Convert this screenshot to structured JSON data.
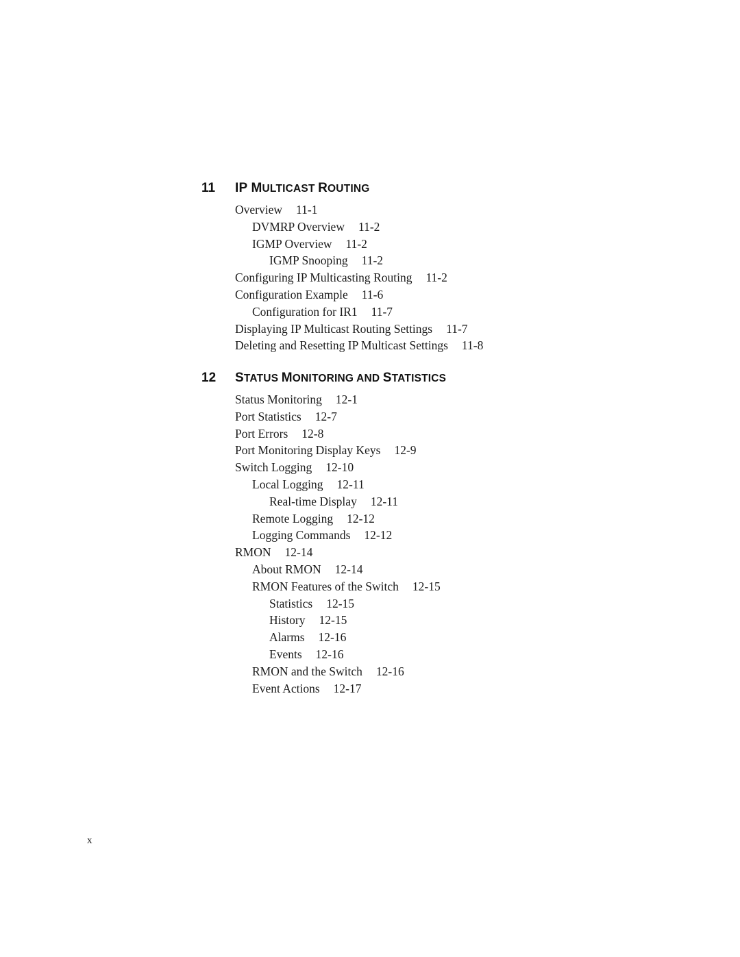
{
  "chapters": [
    {
      "number": "11",
      "title_parts": [
        {
          "t": "I",
          "cap": true
        },
        {
          "t": "P ",
          "cap": true
        },
        {
          "t": "M",
          "cap": true
        },
        {
          "t": "ULTICAST ",
          "cap": false
        },
        {
          "t": "R",
          "cap": true
        },
        {
          "t": "OUTING",
          "cap": false
        }
      ],
      "title": "IP Multicast Routing",
      "entries": [
        {
          "level": 1,
          "text": "Overview",
          "page": "11-1"
        },
        {
          "level": 2,
          "text": "DVMRP Overview",
          "page": "11-2"
        },
        {
          "level": 2,
          "text": "IGMP Overview",
          "page": "11-2"
        },
        {
          "level": 3,
          "text": "IGMP Snooping",
          "page": "11-2"
        },
        {
          "level": 1,
          "text": "Configuring IP Multicasting Routing",
          "page": "11-2"
        },
        {
          "level": 1,
          "text": "Configuration Example",
          "page": "11-6"
        },
        {
          "level": 2,
          "text": "Configuration for IR1",
          "page": "11-7"
        },
        {
          "level": 1,
          "text": "Displaying IP Multicast Routing Settings",
          "page": "11-7"
        },
        {
          "level": 1,
          "text": "Deleting and Resetting IP Multicast Settings",
          "page": "11-8"
        }
      ]
    },
    {
      "number": "12",
      "title_parts": [
        {
          "t": "S",
          "cap": true
        },
        {
          "t": "TATUS ",
          "cap": false
        },
        {
          "t": "M",
          "cap": true
        },
        {
          "t": "ONITORING AND ",
          "cap": false
        },
        {
          "t": "S",
          "cap": true
        },
        {
          "t": "TATISTICS",
          "cap": false
        }
      ],
      "title": "Status Monitoring and Statistics",
      "entries": [
        {
          "level": 1,
          "text": "Status Monitoring",
          "page": "12-1"
        },
        {
          "level": 1,
          "text": "Port Statistics",
          "page": "12-7"
        },
        {
          "level": 1,
          "text": "Port Errors",
          "page": "12-8"
        },
        {
          "level": 1,
          "text": "Port Monitoring Display Keys",
          "page": "12-9"
        },
        {
          "level": 1,
          "text": "Switch Logging",
          "page": "12-10"
        },
        {
          "level": 2,
          "text": "Local Logging",
          "page": "12-11"
        },
        {
          "level": 3,
          "text": "Real-time Display",
          "page": "12-11"
        },
        {
          "level": 2,
          "text": "Remote Logging",
          "page": "12-12"
        },
        {
          "level": 2,
          "text": "Logging Commands",
          "page": "12-12"
        },
        {
          "level": 1,
          "text": "RMON",
          "page": "12-14"
        },
        {
          "level": 2,
          "text": "About RMON",
          "page": "12-14"
        },
        {
          "level": 2,
          "text": "RMON Features of the Switch",
          "page": "12-15"
        },
        {
          "level": 3,
          "text": "Statistics",
          "page": "12-15"
        },
        {
          "level": 3,
          "text": "History",
          "page": "12-15"
        },
        {
          "level": 3,
          "text": "Alarms",
          "page": "12-16"
        },
        {
          "level": 3,
          "text": "Events",
          "page": "12-16"
        },
        {
          "level": 2,
          "text": "RMON and the Switch",
          "page": "12-16"
        },
        {
          "level": 2,
          "text": "Event Actions",
          "page": "12-17"
        }
      ]
    }
  ],
  "folio": "x"
}
